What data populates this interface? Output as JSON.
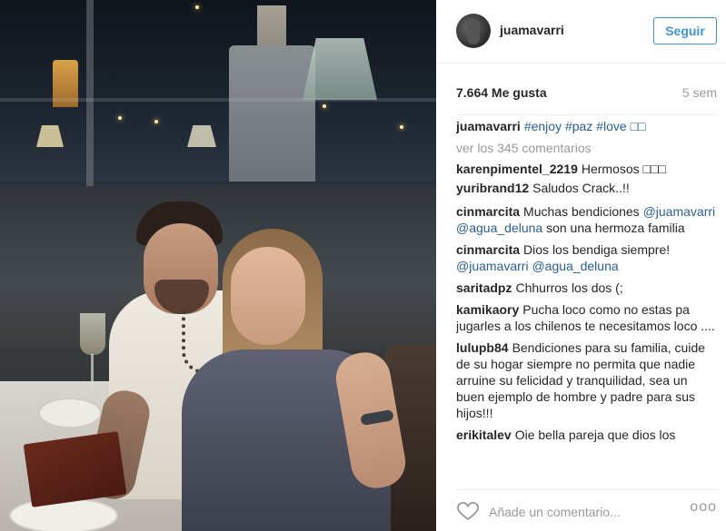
{
  "post": {
    "username": "juamavarri",
    "follow_label": "Seguir",
    "likes": "7.664 Me gusta",
    "age": "5 sem",
    "caption": {
      "author": "juamavarri",
      "text": "#enjoy #paz #love □□"
    },
    "view_all": "ver los 345 comentarios",
    "comments": [
      {
        "author": "karenpimentel_2219",
        "text": "Hermosos □□□"
      },
      {
        "author": "yuribrand12",
        "text": "Saludos Crack..!!"
      },
      {
        "author": "cinmarcita",
        "text": "Muchas bendiciones",
        "tags": "@juamavarri @agua_deluna",
        "rest": "son una hermoza familia"
      },
      {
        "author": "cinmarcita",
        "text": "Dios los bendiga siempre!",
        "tags": "@juamavarri @agua_deluna",
        "rest": ""
      },
      {
        "author": "saritadpz",
        "text": "Chhurros los dos (;"
      },
      {
        "author": "kamikaory",
        "text": "Pucha loco como no estas pa jugarles a los chilenos te necesitamos loco ....",
        "tags": "",
        "rest": ""
      },
      {
        "author": "lulupb84",
        "text": "Bendiciones para su familia, cuide de su hogar siempre no permita que nadie arruine su felicidad y tranquilidad, sea un buen ejemplo de hombre y padre para sus hijos!!!"
      },
      {
        "author": "erikitalev",
        "text": "Oie bella pareja que dios los"
      }
    ],
    "comment_placeholder": "Añade un comentario...",
    "more_label": "ooo"
  },
  "icons": {
    "heart": "heart-icon",
    "avatar": "avatar",
    "more": "more-options-icon"
  },
  "colors": {
    "accent": "#3f93d8",
    "tag": "#2a5f8f",
    "muted": "#999999",
    "text": "#262626"
  }
}
